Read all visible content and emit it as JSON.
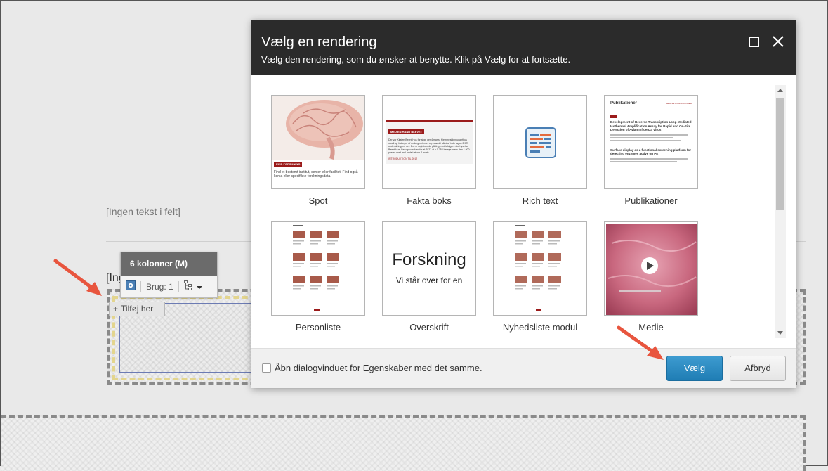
{
  "background": {
    "no_text_1": "[Ingen tekst i felt]",
    "no_text_2": "[Ing",
    "chrome": {
      "title": "6 kolonner (M)",
      "usage_label": "Brug: 1"
    },
    "add_here": "Tilføj her"
  },
  "dialog": {
    "title": "Vælg en rendering",
    "subtitle": "Vælg den rendering, som du ønsker at benytte. Klik på Vælg for at fortsætte.",
    "renderings": [
      {
        "label": "Spot",
        "icon": "spot-thumbnail"
      },
      {
        "label": "Fakta boks",
        "icon": "fact-box-thumbnail"
      },
      {
        "label": "Rich text",
        "icon": "rich-text-thumbnail"
      },
      {
        "label": "Publikationer",
        "icon": "publications-thumbnail"
      },
      {
        "label": "Personliste",
        "icon": "person-list-thumbnail"
      },
      {
        "label": "Overskrift",
        "icon": "heading-thumbnail"
      },
      {
        "label": "Nyhedsliste modul",
        "icon": "news-list-thumbnail"
      },
      {
        "label": "Medie",
        "icon": "media-thumbnail"
      }
    ],
    "spot_thumb": {
      "tag": "FIND FORSKNING",
      "text": "Find et bestemt institut, center eller facilitet. Find også konta eller specifikke forskningsdata."
    },
    "fact_thumb": {
      "tag": "MED EN HAND BLEVET",
      "text": "Der var Kirsten Beent Hus fortalige der 4 marts. Hjemmesiden udarrthus skudt op fraforger af undergrentenlet og mused i alled af indo tagen 2.975 underskringgen der. Det er registrerede på ting med tekligere der hyselse Beent Hus. Besogevuroklen for at 2927 at p.1.754 berage mens den 1.000 ppelse med en I andet tal om 4 marts.",
      "link_text": "INTRODUKTION TIL 2012"
    },
    "pub_thumb": {
      "heading": "Publikationer",
      "tag_right": "SE ALLE PUBLIKATIONER",
      "item1_title": "Development of Reverse Transcription Loop-Mediated Isothermal Amplification Assay for Rapid and On-Site Detection of Avian Influenza Virus",
      "item2_title": "Surface display as a functional screening platform for detecting enzymes active on PET"
    },
    "heading_thumb": {
      "title": "Forskning",
      "subtitle": "Vi står over for en"
    },
    "checkbox_label": "Åbn dialogvinduet for Egenskaber med det samme.",
    "select_button": "Vælg",
    "cancel_button": "Afbryd"
  },
  "colors": {
    "header_bg": "#2b2b2b",
    "primary_button": "#2a8bc4",
    "accent_red": "#9b1b1b",
    "arrow": "#e8553e"
  }
}
